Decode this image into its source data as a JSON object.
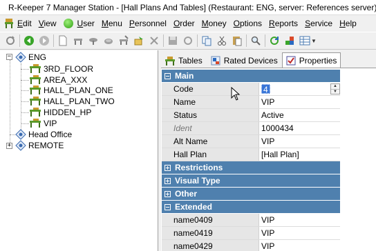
{
  "window": {
    "title": "R-Keeper 7 Manager Station - [Hall Plans And Tables] (Restaurant: ENG, server: References server) -",
    "app_icon": "rkeeper-chair-icon"
  },
  "menu": {
    "items": [
      {
        "label": "Edit",
        "underline": "E",
        "rest": "dit"
      },
      {
        "label": "View",
        "underline": "V",
        "rest": "iew"
      },
      {
        "label": "User",
        "underline": "U",
        "rest": "ser"
      },
      {
        "label": "Menu",
        "underline": "M",
        "rest": "enu"
      },
      {
        "label": "Personnel",
        "underline": "P",
        "rest": "ersonnel"
      },
      {
        "label": "Order",
        "underline": "O",
        "rest": "rder"
      },
      {
        "label": "Money",
        "underline": "M",
        "rest": "oney"
      },
      {
        "label": "Options",
        "underline": "O",
        "rest": "ptions"
      },
      {
        "label": "Reports",
        "underline": "R",
        "rest": "eports"
      },
      {
        "label": "Service",
        "underline": "S",
        "rest": "ervice"
      },
      {
        "label": "Help",
        "underline": "H",
        "rest": "elp"
      }
    ]
  },
  "toolbar": {
    "icons": [
      "refresh-icon",
      "back-icon",
      "forward-icon",
      "new-document-icon",
      "new-table-icon",
      "table-icon",
      "hall-icon",
      "table-edit-icon",
      "export-icon",
      "delete-icon",
      "save-icon",
      "undo-icon",
      "copy-icon",
      "cut-icon",
      "paste-icon",
      "search-icon",
      "sync-icon",
      "palette-icon",
      "grid-view-icon"
    ]
  },
  "tree": {
    "nodes": [
      {
        "label": "ENG",
        "level": 0,
        "icon": "restaurant-icon",
        "expander": "−"
      },
      {
        "label": "3RD_FLOOR",
        "level": 1,
        "icon": "hall-plan-icon"
      },
      {
        "label": "AREA_XXX",
        "level": 1,
        "icon": "hall-plan-icon"
      },
      {
        "label": "HALL_PLAN_ONE",
        "level": 1,
        "icon": "hall-plan-icon"
      },
      {
        "label": "HALL_PLAN_TWO",
        "level": 1,
        "icon": "hall-plan-icon"
      },
      {
        "label": "HIDDEN_HP",
        "level": 1,
        "icon": "hall-plan-icon"
      },
      {
        "label": "VIP",
        "level": 1,
        "icon": "hall-plan-icon"
      },
      {
        "label": "Head Office",
        "level": 0,
        "icon": "restaurant-icon"
      },
      {
        "label": "REMOTE",
        "level": 0,
        "icon": "restaurant-icon",
        "expander": "+"
      }
    ]
  },
  "tabs": [
    {
      "label": "Tables",
      "icon": "tables-icon",
      "active": false
    },
    {
      "label": "Rated Devices",
      "icon": "devices-icon",
      "active": false
    },
    {
      "label": "Properties",
      "icon": "properties-icon",
      "active": true
    }
  ],
  "properties": {
    "main": {
      "title": "Main",
      "rows": [
        {
          "caption": "Code",
          "value": "4"
        },
        {
          "caption": "Name",
          "value": "VIP"
        },
        {
          "caption": "Status",
          "value": "Active"
        },
        {
          "caption": "Ident",
          "value": "1000434"
        },
        {
          "caption": "Alt Name",
          "value": "VIP"
        },
        {
          "caption": "Hall Plan",
          "value": "[Hall Plan]"
        }
      ]
    },
    "groups": [
      {
        "title": "Restrictions",
        "collapsed": true
      },
      {
        "title": "Visual Type",
        "collapsed": true
      },
      {
        "title": "Other",
        "collapsed": true
      }
    ],
    "extended": {
      "title": "Extended",
      "rows": [
        {
          "caption": "name0409",
          "value": "VIP"
        },
        {
          "caption": "name0419",
          "value": "VIP"
        },
        {
          "caption": "name0429",
          "value": "VIP"
        }
      ]
    }
  },
  "colors": {
    "group_header": "#4f80ae",
    "selection": "#3875d7",
    "caption_bg": "#e6e6e6"
  }
}
